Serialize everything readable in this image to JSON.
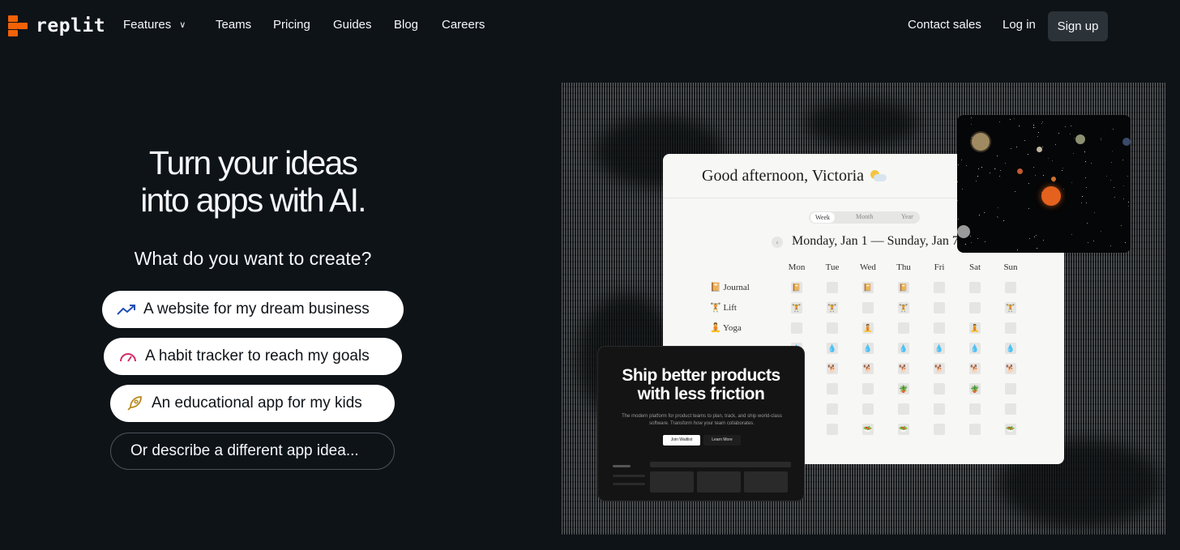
{
  "brand": {
    "name": "replit",
    "accent": "#f26207"
  },
  "nav": {
    "left": [
      {
        "label": "Features",
        "has_menu": true
      },
      {
        "label": "Teams"
      },
      {
        "label": "Pricing"
      },
      {
        "label": "Guides"
      },
      {
        "label": "Blog"
      },
      {
        "label": "Careers"
      }
    ],
    "right": {
      "contact": "Contact sales",
      "login": "Log in",
      "signup": "Sign up"
    }
  },
  "hero": {
    "title_line1": "Turn your ideas",
    "title_line2": "into apps with AI.",
    "question": "What do you want to create?",
    "suggestions": [
      {
        "label": "A website for my dream business",
        "icon": "trending-up-icon",
        "icon_color": "#1f4fb4"
      },
      {
        "label": "A habit tracker to reach my goals",
        "icon": "gauge-icon",
        "icon_color": "#d12e6a"
      },
      {
        "label": "An educational app for my kids",
        "icon": "rocket-icon",
        "icon_color": "#b98a19"
      }
    ],
    "describe_label": "Or describe a different app idea..."
  },
  "calendar": {
    "greeting": "Good afternoon, Victoria",
    "views": [
      "Week",
      "Month",
      "Year"
    ],
    "active_view": "Week",
    "range": "Monday, Jan 1 — Sunday, Jan 7",
    "days": [
      "Mon",
      "Tue",
      "Wed",
      "Thu",
      "Fri",
      "Sat",
      "Sun"
    ],
    "habits": [
      {
        "emoji": "📔",
        "name": "Journal"
      },
      {
        "emoji": "🏋",
        "name": "Lift"
      },
      {
        "emoji": "🧘",
        "name": "Yoga"
      }
    ]
  },
  "promo": {
    "headline_line1": "Ship better products",
    "headline_line2": "with less friction",
    "body": "The modern platform for product teams to plan, track, and ship world-class software. Transform how your team collaborates.",
    "primary_cta": "Join Waitlist",
    "secondary_cta": "Learn More"
  }
}
